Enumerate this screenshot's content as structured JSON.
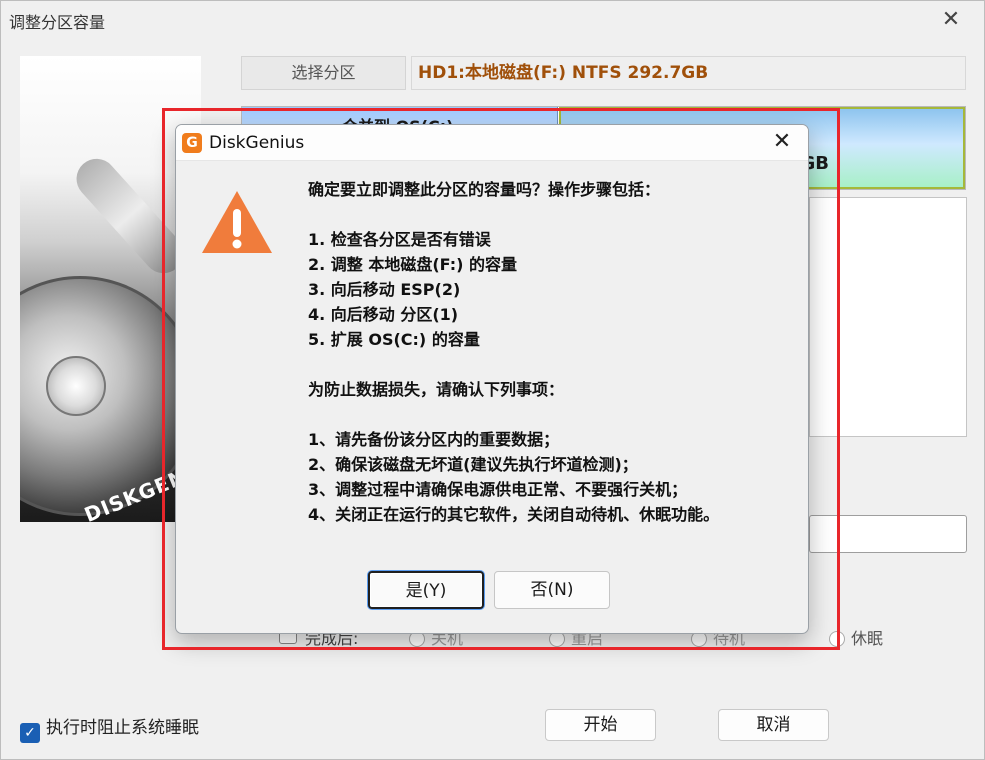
{
  "window": {
    "title": "调整分区容量"
  },
  "left_image": {
    "logo_text": "DISKGENIUS"
  },
  "select_partition_button": "选择分区",
  "partition_info": "HD1:本地磁盘(F:) NTFS 292.7GB",
  "partition_bar": {
    "left_label": "合并到 OS(C:)",
    "right_label_suffix": "GB"
  },
  "after_completion": {
    "label": "完成后:",
    "options": [
      "关机",
      "重启",
      "待机",
      "休眠"
    ]
  },
  "prevent_sleep_label": "执行时阻止系统睡眠",
  "buttons": {
    "start": "开始",
    "cancel": "取消"
  },
  "dialog": {
    "title": "DiskGenius",
    "icon_letter": "G",
    "message_lines": [
      "确定要立即调整此分区的容量吗？操作步骤包括：",
      "",
      "1. 检查各分区是否有错误",
      "2. 调整 本地磁盘(F:) 的容量",
      "3. 向后移动 ESP(2)",
      "4. 向后移动 分区(1)",
      "5. 扩展 OS(C:) 的容量",
      "",
      "为防止数据损失，请确认下列事项：",
      "",
      "1、请先备份该分区内的重要数据；",
      "2、确保该磁盘无坏道(建议先执行坏道检测)；",
      "3、调整过程中请确保电源供电正常、不要强行关机；",
      "4、关闭正在运行的其它软件，关闭自动待机、休眠功能。"
    ],
    "yes_label": "是(Y)",
    "no_label": "否(N)"
  },
  "colors": {
    "highlight_border": "#e8262b",
    "partition_info_text": "#a0500a",
    "warning_icon": "#f07c3c"
  }
}
